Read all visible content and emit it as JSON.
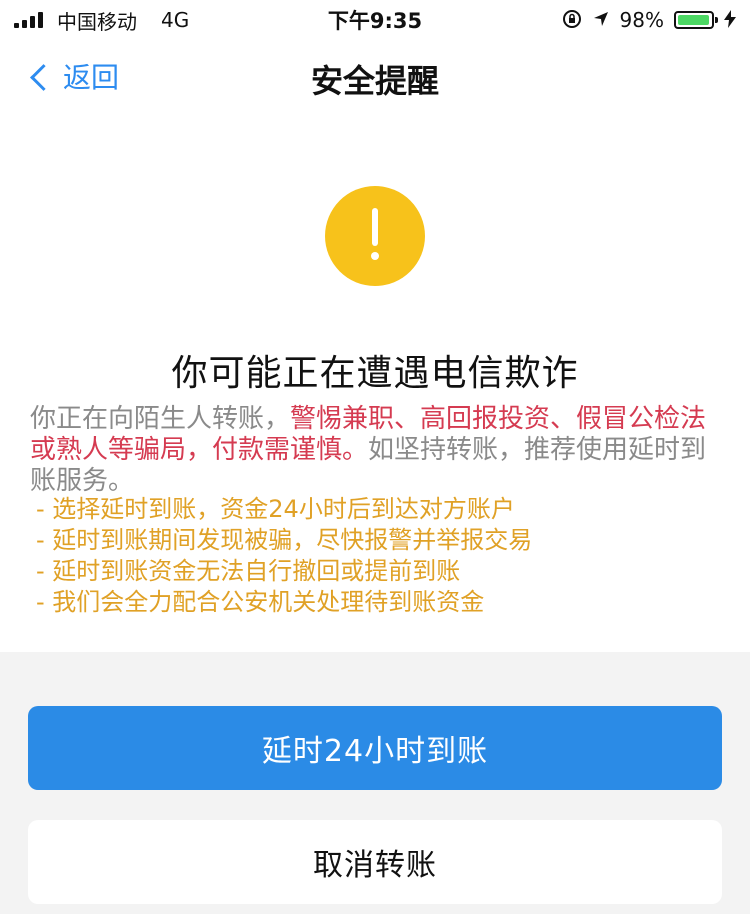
{
  "status_bar": {
    "carrier": "中国移动",
    "network": "4G",
    "time": "下午9:35",
    "battery_percent_label": "98%",
    "battery_level": 0.98,
    "icons": [
      "orientation-lock-icon",
      "location-arrow-icon",
      "charging-bolt-icon"
    ]
  },
  "nav": {
    "back_label": "返回",
    "title": "安全提醒"
  },
  "warning_icon": "exclamation-circle-icon",
  "headline": "你可能正在遭遇电信欺诈",
  "description": {
    "intro": "你正在向陌生人转账，",
    "danger": "警惕兼职、高回报投资、假冒公检法或熟人等骗局，付款需谨慎。",
    "outro": "如坚持转账，推荐使用延时到账服务。"
  },
  "tips": [
    "- 选择延时到账，资金24小时后到达对方账户",
    "- 延时到账期间发现被骗，尽快报警并举报交易",
    "- 延时到账资金无法自行撤回或提前到账",
    "- 我们会全力配合公安机关处理待到账资金"
  ],
  "buttons": {
    "primary": "延时24小时到账",
    "secondary": "取消转账"
  },
  "colors": {
    "accent_blue": "#2b8be6",
    "warning_yellow": "#f7c21b",
    "danger_red": "#d53b51",
    "tip_orange": "#e0a126",
    "battery_green": "#4cd964"
  }
}
